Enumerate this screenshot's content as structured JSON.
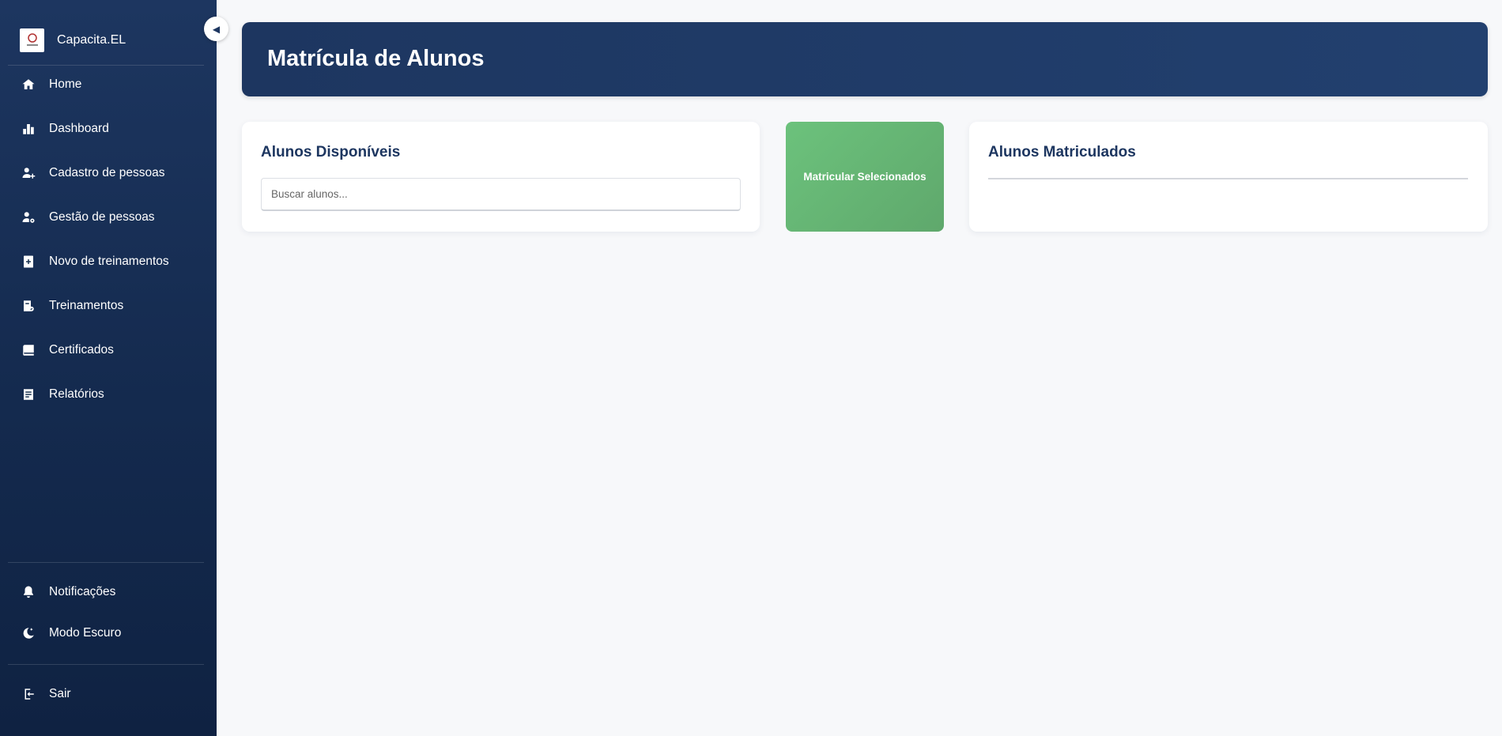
{
  "app": {
    "name": "Capacita.EL",
    "logo_icon": "company-logo-icon"
  },
  "sidebar": {
    "collapse_icon": "chevron-left-icon",
    "items": [
      {
        "label": "Home",
        "icon": "home-icon"
      },
      {
        "label": "Dashboard",
        "icon": "bar-chart-icon"
      },
      {
        "label": "Cadastro de pessoas",
        "icon": "user-add-icon"
      },
      {
        "label": "Gestão de pessoas",
        "icon": "user-settings-icon"
      },
      {
        "label": "Novo de treinamentos",
        "icon": "notebook-add-icon"
      },
      {
        "label": "Treinamentos",
        "icon": "training-icon"
      },
      {
        "label": "Certificados",
        "icon": "certificate-icon"
      },
      {
        "label": "Relatórios",
        "icon": "report-icon"
      }
    ],
    "bottom": [
      {
        "label": "Notificações",
        "icon": "bell-icon"
      },
      {
        "label": "Modo Escuro",
        "icon": "moon-icon"
      }
    ],
    "logout": {
      "label": "Sair",
      "icon": "logout-icon"
    }
  },
  "header": {
    "title": "Matrícula de Alunos"
  },
  "available": {
    "title": "Alunos Disponíveis",
    "search_placeholder": "Buscar alunos..."
  },
  "actions": {
    "enroll_label": "Matricular Selecionados"
  },
  "enrolled": {
    "title": "Alunos Matriculados"
  },
  "colors": {
    "sidebar": "#1d3660",
    "accent_green": "#66b877",
    "background": "#f7f8fa"
  }
}
